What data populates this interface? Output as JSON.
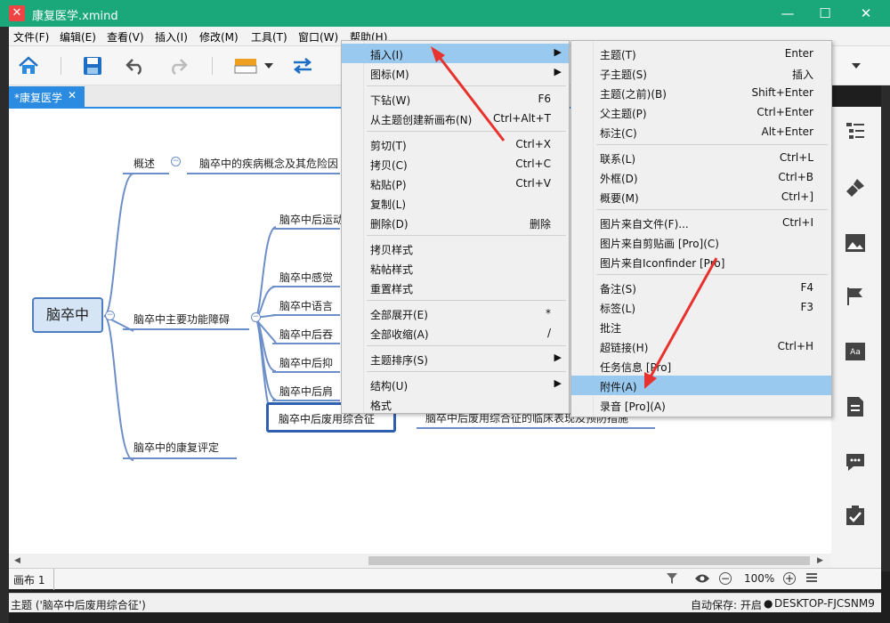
{
  "window": {
    "title": "康复医学.xmind",
    "logo_glyph": "✕",
    "controls": [
      "—",
      "☐",
      "✕"
    ]
  },
  "menubar": [
    "文件(F)",
    "编辑(E)",
    "查看(V)",
    "插入(I)",
    "修改(M)",
    "工具(T)",
    "窗口(W)",
    "帮助(H)"
  ],
  "tab": {
    "label": "*康复医学",
    "close": "✕"
  },
  "mindmap": {
    "root": "脑卒中",
    "branches": {
      "overview": "概述",
      "overview_detail": "脑卒中的疾病概念及其危险因",
      "main_disorders": "脑卒中主要功能障碍",
      "evaluation": "脑卒中的康复评定"
    },
    "sub_nodes": [
      "脑卒中后运动",
      "脑卒中感觉",
      "脑卒中语言",
      "脑卒中后吞",
      "脑卒中后抑",
      "脑卒中后肩",
      "脑卒中后废用综合征"
    ],
    "selected_detail": "脑卒中后废用综合征的临床表现及预防措施"
  },
  "context_menu": [
    {
      "label": "插入(I)",
      "shortcut": "",
      "submenu": true,
      "highlight": true
    },
    {
      "label": "图标(M)",
      "shortcut": "",
      "submenu": true
    },
    {
      "sep": true
    },
    {
      "label": "下钻(W)",
      "shortcut": "F6"
    },
    {
      "label": "从主题创建新画布(N)",
      "shortcut": "Ctrl+Alt+T"
    },
    {
      "sep": true
    },
    {
      "label": "剪切(T)",
      "shortcut": "Ctrl+X"
    },
    {
      "label": "拷贝(C)",
      "shortcut": "Ctrl+C"
    },
    {
      "label": "粘贴(P)",
      "shortcut": "Ctrl+V"
    },
    {
      "label": "复制(L)",
      "shortcut": ""
    },
    {
      "label": "删除(D)",
      "shortcut": "删除"
    },
    {
      "sep": true
    },
    {
      "label": "拷贝样式",
      "shortcut": ""
    },
    {
      "label": "粘帖样式",
      "shortcut": ""
    },
    {
      "label": "重置样式",
      "shortcut": ""
    },
    {
      "sep": true
    },
    {
      "label": "全部展开(E)",
      "shortcut": "*"
    },
    {
      "label": "全部收缩(A)",
      "shortcut": "/"
    },
    {
      "sep": true
    },
    {
      "label": "主题排序(S)",
      "shortcut": "",
      "submenu": true
    },
    {
      "sep": true
    },
    {
      "label": "结构(U)",
      "shortcut": "",
      "submenu": true
    },
    {
      "label": "格式",
      "shortcut": ""
    }
  ],
  "submenu": [
    {
      "label": "主题(T)",
      "shortcut": "Enter"
    },
    {
      "label": "子主题(S)",
      "shortcut": "插入"
    },
    {
      "label": "主题(之前)(B)",
      "shortcut": "Shift+Enter"
    },
    {
      "label": "父主题(P)",
      "shortcut": "Ctrl+Enter"
    },
    {
      "label": "标注(C)",
      "shortcut": "Alt+Enter"
    },
    {
      "sep": true
    },
    {
      "label": "联系(L)",
      "shortcut": "Ctrl+L"
    },
    {
      "label": "外框(D)",
      "shortcut": "Ctrl+B"
    },
    {
      "label": "概要(M)",
      "shortcut": "Ctrl+]"
    },
    {
      "sep": true
    },
    {
      "label": "图片来自文件(F)...",
      "shortcut": "Ctrl+I"
    },
    {
      "label": "图片来自剪贴画 [Pro](C)",
      "shortcut": ""
    },
    {
      "label": "图片来自Iconfinder [Pro]",
      "shortcut": ""
    },
    {
      "sep": true
    },
    {
      "label": "备注(S)",
      "shortcut": "F4"
    },
    {
      "label": "标签(L)",
      "shortcut": "F3"
    },
    {
      "label": "批注",
      "shortcut": ""
    },
    {
      "label": "超链接(H)",
      "shortcut": "Ctrl+H"
    },
    {
      "label": "任务信息 [Pro]",
      "shortcut": ""
    },
    {
      "label": "附件(A)",
      "shortcut": "",
      "highlight": true
    },
    {
      "label": "录音 [Pro](A)",
      "shortcut": ""
    }
  ],
  "sheet_tab": "画布 1",
  "zoom": "100%",
  "status": {
    "topic": "主题 ('脑卒中后废用综合征')",
    "autosave": "自动保存: 开启",
    "computer": "DESKTOP-FJCSNM9"
  },
  "colors": {
    "titlebar": "#1aa87a",
    "accent": "#2a8be0",
    "highlight": "#99c9ef",
    "arrow": "#e8322d"
  }
}
